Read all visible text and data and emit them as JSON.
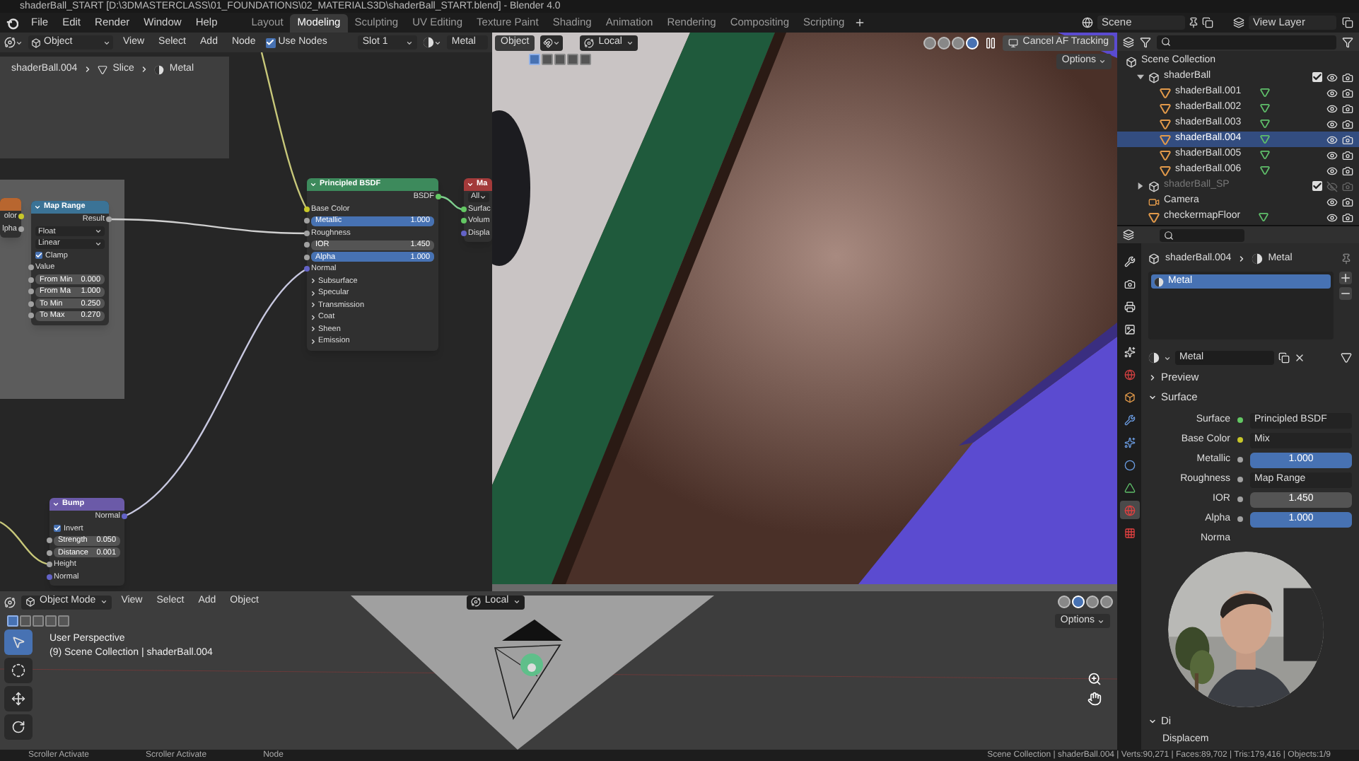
{
  "window": {
    "title": "shaderBall_START [D:\\3DMASTERCLASS\\01_FOUNDATIONS\\02_MATERIALS3D\\shaderBall_START.blend] - Blender 4.0"
  },
  "menu": [
    "File",
    "Edit",
    "Render",
    "Window",
    "Help"
  ],
  "workspaces": [
    {
      "label": "Layout",
      "selected": false
    },
    {
      "label": "Modeling",
      "selected": true
    },
    {
      "label": "Sculpting",
      "selected": false
    },
    {
      "label": "UV Editing",
      "selected": false
    },
    {
      "label": "Texture Paint",
      "selected": false
    },
    {
      "label": "Shading",
      "selected": false
    },
    {
      "label": "Animation",
      "selected": false
    },
    {
      "label": "Rendering",
      "selected": false
    },
    {
      "label": "Compositing",
      "selected": false
    },
    {
      "label": "Scripting",
      "selected": false
    }
  ],
  "scene": "Scene",
  "view_layer": "View Layer",
  "node_editor": {
    "mode": "Object",
    "menus": [
      "View",
      "Select",
      "Add",
      "Node"
    ],
    "use_nodes": {
      "label": "Use Nodes",
      "checked": true
    },
    "slot": "Slot 1",
    "material": "Metal",
    "breadcrumb": [
      "shaderBall.004",
      "Slice",
      "Metal"
    ],
    "nodes": [
      {
        "color": "#b8662f",
        "rows": [
          {
            "kind": "output",
            "label": "olor",
            "color": "#c7c729"
          },
          {
            "kind": "output",
            "label": "lpha",
            "color": "#a1a1a1"
          }
        ]
      },
      {
        "title": "Map Range",
        "color": "#3b7396",
        "rows": [
          {
            "kind": "output",
            "label": "Result",
            "color": "#a1a1a1"
          },
          {
            "kind": "dropdown",
            "value": "Float"
          },
          {
            "kind": "dropdown",
            "value": "Linear"
          },
          {
            "kind": "checkbox",
            "label": "Clamp",
            "checked": true
          },
          {
            "kind": "input",
            "label": "Value",
            "color": "#a1a1a1"
          },
          {
            "kind": "value",
            "label": "From Min",
            "value": "0.000",
            "color": "#a1a1a1"
          },
          {
            "kind": "value",
            "label": "From Ma",
            "value": "1.000",
            "color": "#a1a1a1"
          },
          {
            "kind": "value",
            "label": "To Min",
            "value": "0.250",
            "color": "#a1a1a1"
          },
          {
            "kind": "value",
            "label": "To Max",
            "value": "0.270",
            "color": "#a1a1a1"
          }
        ]
      },
      {
        "title": "Principled BSDF",
        "color": "#3d8a5c",
        "rows": [
          {
            "kind": "output",
            "label": "BSDF",
            "color": "#63c763"
          },
          {
            "kind": "input",
            "label": "Base Color",
            "color": "#c7c729"
          },
          {
            "kind": "slider",
            "label": "Metallic",
            "value": "1.000",
            "level": 1,
            "color": "#a1a1a1"
          },
          {
            "kind": "input",
            "label": "Roughness",
            "color": "#a1a1a1"
          },
          {
            "kind": "value",
            "label": "IOR",
            "value": "1.450",
            "color": "#a1a1a1"
          },
          {
            "kind": "slider",
            "label": "Alpha",
            "value": "1.000",
            "level": 1,
            "color": "#a1a1a1"
          },
          {
            "kind": "input",
            "label": "Normal",
            "color": "#6363c7"
          },
          {
            "kind": "panel",
            "label": "Subsurface"
          },
          {
            "kind": "panel",
            "label": "Specular"
          },
          {
            "kind": "panel",
            "label": "Transmission"
          },
          {
            "kind": "panel",
            "label": "Coat"
          },
          {
            "kind": "panel",
            "label": "Sheen"
          },
          {
            "kind": "panel",
            "label": "Emission"
          }
        ]
      },
      {
        "title": "Ma",
        "color": "#a33a3a",
        "rows": [
          {
            "kind": "dropdown",
            "value": "All"
          },
          {
            "kind": "input",
            "label": "Surfac",
            "color": "#63c763"
          },
          {
            "kind": "input",
            "label": "Volum",
            "color": "#63c763"
          },
          {
            "kind": "input",
            "label": "Displa",
            "color": "#6363c7"
          }
        ]
      },
      {
        "title": "Bump",
        "color": "#6b5aa8",
        "rows": [
          {
            "kind": "output",
            "label": "Normal",
            "color": "#6363c7"
          },
          {
            "kind": "checkbox",
            "label": "Invert",
            "checked": true
          },
          {
            "kind": "value",
            "label": "Strength",
            "value": "0.050",
            "color": "#a1a1a1"
          },
          {
            "kind": "value",
            "label": "Distance",
            "value": "0.001",
            "color": "#a1a1a1"
          },
          {
            "kind": "input",
            "label": "Height",
            "color": "#a1a1a1"
          },
          {
            "kind": "input",
            "label": "Normal",
            "color": "#6363c7"
          }
        ]
      }
    ]
  },
  "viewport": {
    "mode": "Object",
    "orientation": "Local",
    "select_modes": [
      {
        "selected": true
      },
      {
        "selected": false
      },
      {
        "selected": false
      },
      {
        "selected": false
      },
      {
        "selected": false
      }
    ],
    "shading": [
      {
        "selected": false
      },
      {
        "selected": false
      },
      {
        "selected": false
      },
      {
        "selected": true
      }
    ],
    "tracking": "Cancel AF Tracking",
    "options": "Options"
  },
  "outliner": {
    "items": [
      {
        "label": "Scene Collection",
        "kind": "scene",
        "selected": false,
        "children": [
          {
            "label": "shaderBall",
            "kind": "collection",
            "selected": false,
            "hidden": false,
            "expanded": true,
            "children": [
              {
                "label": "shaderBall.001",
                "kind": "mesh",
                "selected": false,
                "hidden": false
              },
              {
                "label": "shaderBall.002",
                "kind": "mesh",
                "selected": false,
                "hidden": false
              },
              {
                "label": "shaderBall.003",
                "kind": "mesh",
                "selected": false,
                "hidden": false
              },
              {
                "label": "shaderBall.004",
                "kind": "mesh",
                "selected": true,
                "hidden": false
              },
              {
                "label": "shaderBall.005",
                "kind": "mesh",
                "selected": false,
                "hidden": false
              },
              {
                "label": "shaderBall.006",
                "kind": "mesh",
                "selected": false,
                "hidden": false
              }
            ]
          },
          {
            "label": "shaderBall_SP",
            "kind": "collection",
            "selected": false,
            "hidden": true,
            "expanded": false
          },
          {
            "label": "Camera",
            "kind": "camera",
            "selected": false,
            "hidden": false
          },
          {
            "label": "checkermapFloor",
            "kind": "mesh",
            "selected": false,
            "hidden": false
          }
        ]
      }
    ]
  },
  "properties": {
    "tabs": [
      {
        "kind": "tool",
        "selected": false
      },
      {
        "kind": "render",
        "selected": false
      },
      {
        "kind": "output",
        "selected": false
      },
      {
        "kind": "view_layer",
        "selected": false
      },
      {
        "kind": "scene",
        "selected": false
      },
      {
        "kind": "world",
        "selected": false
      },
      {
        "kind": "object",
        "selected": false
      },
      {
        "kind": "modifier",
        "selected": false
      },
      {
        "kind": "particles",
        "selected": false
      },
      {
        "kind": "physics",
        "selected": false
      },
      {
        "kind": "data",
        "selected": false
      },
      {
        "kind": "material",
        "selected": true
      },
      {
        "kind": "texture",
        "selected": false
      }
    ],
    "breadcrumb": [
      "shaderBall.004",
      "Metal"
    ],
    "slots": [
      {
        "label": "Metal",
        "selected": true
      }
    ],
    "material": "Metal",
    "sections": [
      {
        "label": "Preview",
        "expanded": false
      },
      {
        "label": "Surface",
        "expanded": true
      }
    ],
    "rows": [
      {
        "kind": "link",
        "label": "Surface",
        "value": "Principled BSDF",
        "color": "#63c763"
      },
      {
        "kind": "link",
        "label": "Base Color",
        "value": "Mix",
        "color": "#c7c729"
      },
      {
        "kind": "slider",
        "label": "Metallic",
        "value": "1.000",
        "level": 1,
        "color": "#a1a1a1"
      },
      {
        "kind": "link",
        "label": "Roughness",
        "value": "Map Range",
        "color": "#a1a1a1"
      },
      {
        "kind": "number",
        "label": "IOR",
        "value": "1.450",
        "color": "#a1a1a1"
      },
      {
        "kind": "slider",
        "label": "Alpha",
        "value": "1.000",
        "level": 1,
        "color": "#a1a1a1"
      },
      {
        "kind": "label",
        "label": "Norma"
      }
    ],
    "lower_section": {
      "label": "Di",
      "expanded": true
    },
    "lower_row": "Displacem"
  },
  "bottom_viewport": {
    "mode": "Object Mode",
    "menus": [
      "View",
      "Select",
      "Add",
      "Object"
    ],
    "orientation": "Local",
    "options": "Options",
    "select_modes": [
      {
        "selected": true
      },
      {
        "selected": false
      },
      {
        "selected": false
      },
      {
        "selected": false
      },
      {
        "selected": false
      }
    ],
    "shading": [
      {
        "selected": false
      },
      {
        "selected": true
      },
      {
        "selected": false
      },
      {
        "selected": false
      }
    ],
    "tools": [
      {
        "kind": "select",
        "selected": true
      },
      {
        "kind": "cursor",
        "selected": false
      },
      {
        "kind": "move",
        "selected": false
      },
      {
        "kind": "rotate",
        "selected": false
      }
    ],
    "info": [
      "User Perspective",
      "(9) Scene Collection | shaderBall.004"
    ]
  },
  "webcam": {
    "kind": "picture"
  },
  "status_bar": {
    "left": [
      "Scroller Activate",
      "Scroller Activate",
      "Node"
    ],
    "right": "Scene Collection | shaderBall.004 | Verts:90,271 | Faces:89,702 | Tris:179,416 | Objects:1/9"
  }
}
